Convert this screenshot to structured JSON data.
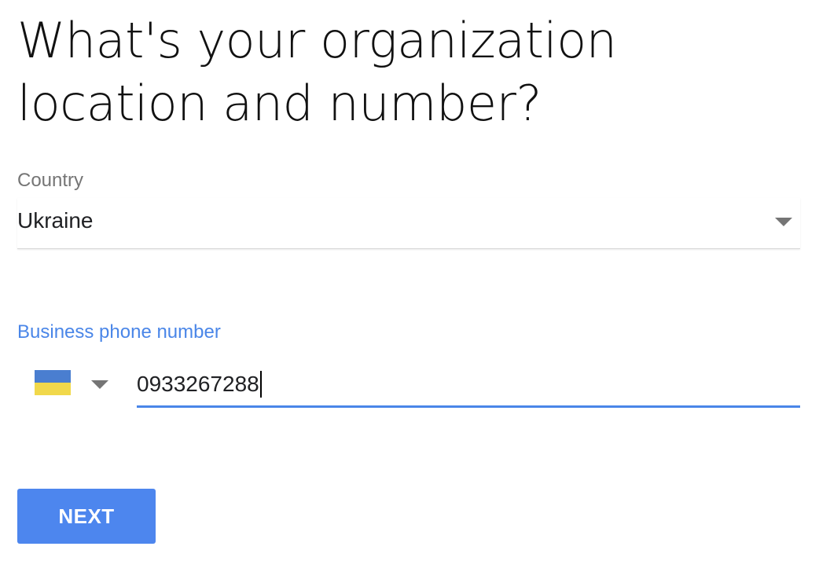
{
  "page": {
    "title": "What's your organization location and number?"
  },
  "country": {
    "label": "Country",
    "value": "Ukraine",
    "arrow_icon": "dropdown-arrow-icon"
  },
  "phone": {
    "label": "Business phone number",
    "flag_icon": "ukraine-flag-icon",
    "flag_colors": {
      "top": "#4a7ed0",
      "bottom": "#f1d84b"
    },
    "value": "0933267288"
  },
  "actions": {
    "next_label": "NEXT"
  },
  "colors": {
    "accent": "#4a86e8",
    "button": "#4d86ee",
    "label_gray": "#757575"
  }
}
